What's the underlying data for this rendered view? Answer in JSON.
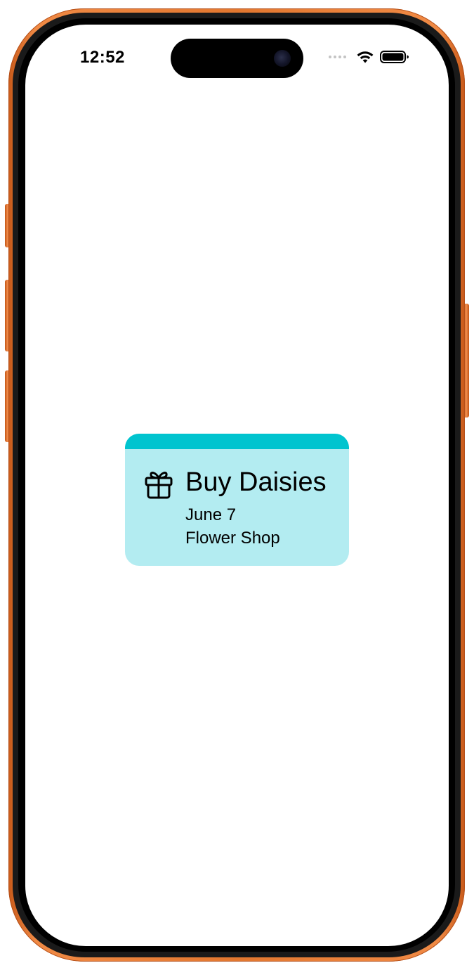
{
  "status_bar": {
    "time": "12:52",
    "wifi_icon": "wifi-icon",
    "battery_icon": "battery-icon"
  },
  "reminder": {
    "icon": "gift-icon",
    "title": "Buy Daisies",
    "date": "June 7",
    "location": "Flower Shop"
  },
  "colors": {
    "frame": "#e2772f",
    "card_background": "#b3ecf1",
    "card_accent": "#00c4cf"
  }
}
